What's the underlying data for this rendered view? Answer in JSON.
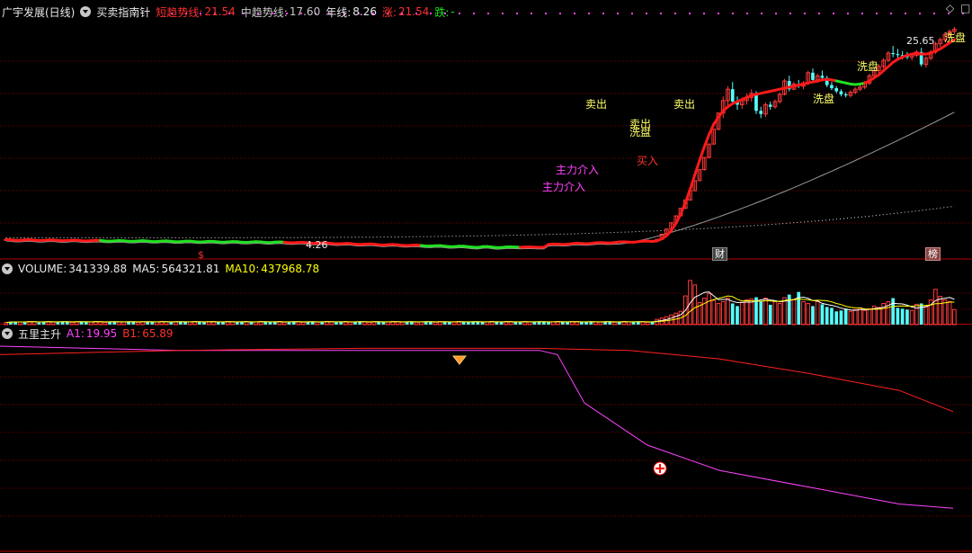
{
  "colors": {
    "bg": "#000000",
    "grid": "#7a0000",
    "up": "#ff3b3b",
    "down": "#54ffff",
    "shortTrend_up": "#ff1a1a",
    "shortTrend_down": "#22e022",
    "midTrend": "#9a9a9a",
    "yearLine": "#e0e0e0",
    "label_yellow": "#ffff66",
    "label_magenta": "#ff44ff",
    "label_red": "#ff3030",
    "volMA5": "#ffffff",
    "volMA10": "#ffff00",
    "A1": "#ff44ff",
    "B1": "#ff2020"
  },
  "header": {
    "title": "广宇发展(日线)",
    "indicator": "买卖指南针",
    "short_trend_label": "短趋势线:",
    "short_trend_value": "21.54",
    "mid_trend_label": "中趋势线:",
    "mid_trend_value": "17.60",
    "year_label": "年线:",
    "year_value": "8.26",
    "rise_label": "涨:",
    "rise_value": "21.54",
    "fall_label": "跌:",
    "fall_value": "-"
  },
  "volume_header": {
    "label": "VOLUME:",
    "value": "341339.88",
    "ma5_label": "MA5:",
    "ma5_value": "564321.81",
    "ma10_label": "MA10:",
    "ma10_value": "437968.78"
  },
  "osc_header": {
    "label": "五里主升",
    "a1_label": "A1:",
    "a1_value": "19.95",
    "b1_label": "B1:",
    "b1_value": "65.89"
  },
  "corner_icons": [
    "diamond-icon",
    "maximize-icon"
  ],
  "price_annotations": {
    "max_label": "25.65",
    "min_label": "4.26",
    "markers": [
      "$",
      "财",
      "榜"
    ],
    "signals": [
      {
        "text": "卖出",
        "color": "yellow"
      },
      {
        "text": "卖出",
        "color": "yellow"
      },
      {
        "text": "洗盘",
        "color": "yellow"
      },
      {
        "text": "卖出",
        "color": "yellow"
      },
      {
        "text": "洗盘",
        "color": "yellow"
      },
      {
        "text": "洗盘",
        "color": "yellow"
      },
      {
        "text": "洗盘",
        "color": "yellow"
      },
      {
        "text": "主力介入",
        "color": "magenta"
      },
      {
        "text": "主力介入",
        "color": "magenta"
      },
      {
        "text": "买入",
        "color": "red"
      }
    ]
  },
  "chart_data": [
    {
      "type": "candlestick",
      "title": "广宇发展(日线)",
      "ylim": [
        3.5,
        26.5
      ],
      "candles_early_flat": 138,
      "early_price_range": [
        4.26,
        5.2
      ],
      "candles": [
        [
          4.9,
          5.1,
          4.85,
          5.05
        ],
        [
          5.05,
          5.6,
          5.0,
          5.55
        ],
        [
          5.55,
          6.1,
          5.5,
          6.05
        ],
        [
          6.05,
          6.66,
          6.0,
          6.66
        ],
        [
          6.66,
          7.33,
          6.6,
          7.33
        ],
        [
          7.33,
          8.06,
          7.3,
          8.06
        ],
        [
          8.06,
          8.87,
          8.0,
          8.87
        ],
        [
          8.87,
          9.76,
          8.8,
          9.76
        ],
        [
          9.76,
          10.74,
          9.7,
          10.74
        ],
        [
          10.74,
          11.81,
          10.7,
          11.81
        ],
        [
          11.81,
          12.99,
          11.7,
          12.99
        ],
        [
          12.99,
          14.29,
          12.9,
          14.29
        ],
        [
          14.29,
          15.72,
          14.2,
          15.72
        ],
        [
          15.72,
          17.29,
          15.6,
          17.29
        ],
        [
          17.29,
          18.9,
          16.8,
          18.5
        ],
        [
          18.5,
          19.9,
          17.8,
          19.6
        ],
        [
          19.6,
          20.3,
          18.1,
          18.4
        ],
        [
          18.4,
          18.9,
          17.6,
          18.1
        ],
        [
          18.1,
          18.8,
          17.7,
          18.5
        ],
        [
          18.5,
          19.2,
          18.1,
          18.8
        ],
        [
          18.8,
          19.6,
          18.4,
          19.2
        ],
        [
          19.2,
          19.4,
          17.2,
          17.5
        ],
        [
          17.5,
          17.9,
          16.8,
          17.2
        ],
        [
          17.2,
          18.3,
          16.9,
          18.1
        ],
        [
          18.1,
          18.4,
          17.6,
          17.9
        ],
        [
          17.9,
          18.6,
          17.7,
          18.4
        ],
        [
          18.4,
          19.3,
          18.2,
          19.1
        ],
        [
          19.1,
          20.6,
          19.0,
          20.4
        ],
        [
          20.4,
          20.9,
          19.4,
          19.6
        ],
        [
          19.6,
          20.3,
          19.5,
          20.1
        ],
        [
          20.1,
          20.5,
          19.7,
          19.9
        ],
        [
          19.9,
          20.4,
          19.6,
          20.2
        ],
        [
          20.2,
          21.4,
          20.0,
          21.2
        ],
        [
          21.2,
          21.6,
          20.3,
          20.5
        ],
        [
          20.5,
          21.1,
          20.2,
          20.9
        ],
        [
          20.9,
          21.4,
          20.5,
          20.7
        ],
        [
          20.7,
          20.9,
          19.8,
          20.0
        ],
        [
          20.0,
          20.3,
          19.5,
          19.7
        ],
        [
          19.7,
          19.9,
          19.2,
          19.4
        ],
        [
          19.4,
          19.6,
          18.9,
          19.1
        ],
        [
          19.1,
          19.3,
          18.8,
          19.0
        ],
        [
          19.0,
          19.5,
          18.8,
          19.3
        ],
        [
          19.3,
          19.8,
          19.1,
          19.6
        ],
        [
          19.6,
          20.0,
          19.4,
          19.8
        ],
        [
          19.8,
          20.4,
          19.6,
          20.2
        ],
        [
          20.2,
          21.1,
          20.0,
          20.9
        ],
        [
          20.9,
          21.6,
          20.7,
          21.4
        ],
        [
          21.4,
          22.0,
          21.1,
          21.8
        ],
        [
          21.8,
          22.6,
          21.6,
          22.4
        ],
        [
          22.4,
          23.3,
          22.2,
          23.1
        ],
        [
          23.1,
          23.8,
          22.7,
          23.0
        ],
        [
          23.0,
          23.5,
          22.6,
          22.9
        ],
        [
          22.9,
          23.3,
          22.5,
          22.8
        ],
        [
          22.8,
          23.2,
          22.5,
          22.7
        ],
        [
          22.7,
          23.1,
          22.4,
          22.9
        ],
        [
          22.9,
          23.4,
          22.7,
          23.2
        ],
        [
          23.2,
          23.6,
          21.8,
          22.0
        ],
        [
          22.0,
          22.8,
          21.7,
          22.6
        ],
        [
          22.6,
          23.4,
          22.4,
          23.2
        ],
        [
          23.2,
          24.2,
          23.0,
          24.0
        ],
        [
          24.0,
          24.6,
          23.7,
          24.4
        ],
        [
          24.4,
          25.1,
          24.2,
          24.9
        ],
        [
          24.9,
          25.4,
          24.6,
          25.2
        ],
        [
          25.2,
          25.65,
          24.9,
          25.4
        ]
      ],
      "short_trend": {
        "recent_value": 21.54
      },
      "mid_trend": {
        "recent_value": 17.6
      },
      "year_line": {
        "recent_value": 8.26
      }
    },
    {
      "type": "bar",
      "title": "VOLUME",
      "ylim": [
        0,
        1100000
      ],
      "early_bar_count": 138,
      "early_volume": 60000,
      "values": [
        120000,
        150000,
        180000,
        220000,
        260000,
        300000,
        650000,
        1000000,
        900000,
        500000,
        600000,
        700000,
        550000,
        480000,
        520000,
        600000,
        480000,
        420000,
        500000,
        560000,
        580000,
        620000,
        540000,
        600000,
        450000,
        520000,
        480000,
        610000,
        680000,
        560000,
        740000,
        520000,
        480000,
        420000,
        520000,
        460000,
        400000,
        380000,
        300000,
        320000,
        360000,
        300000,
        340000,
        380000,
        320000,
        360000,
        420000,
        390000,
        480000,
        520000,
        600000,
        380000,
        360000,
        340000,
        320000,
        460000,
        480000,
        420000,
        560000,
        800000,
        640000,
        560000,
        520000,
        340000
      ],
      "ma5_recent": 564321.81,
      "ma10_recent": 437968.78
    },
    {
      "type": "line",
      "title": "五里主升",
      "ylim": [
        0,
        100
      ],
      "series": [
        {
          "name": "A1",
          "points": [
            [
              0,
              97
            ],
            [
              100,
              96
            ],
            [
              200,
              95
            ],
            [
              300,
              95
            ],
            [
              400,
              95
            ],
            [
              470,
              95
            ],
            [
              600,
              95
            ],
            [
              620,
              93
            ],
            [
              650,
              70
            ],
            [
              720,
              50
            ],
            [
              800,
              38
            ],
            [
              900,
              30
            ],
            [
              1000,
              22
            ],
            [
              1060,
              19.95
            ]
          ]
        },
        {
          "name": "B1",
          "points": [
            [
              0,
              93
            ],
            [
              100,
              94
            ],
            [
              200,
              95
            ],
            [
              300,
              95.5
            ],
            [
              400,
              96
            ],
            [
              500,
              96
            ],
            [
              600,
              96
            ],
            [
              700,
              95
            ],
            [
              800,
              91
            ],
            [
              900,
              84
            ],
            [
              1000,
              76
            ],
            [
              1060,
              65.89
            ]
          ]
        }
      ]
    }
  ]
}
